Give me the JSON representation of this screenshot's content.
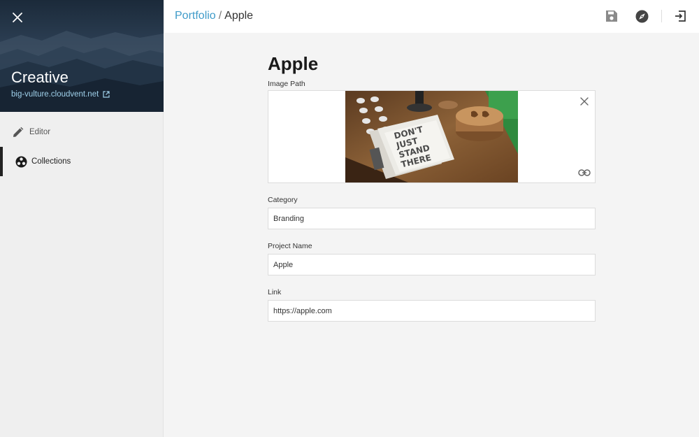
{
  "sidebar": {
    "title": "Creative",
    "site_link": "big-vulture.cloudvent.net",
    "items": [
      {
        "label": "Editor",
        "icon": "pencil-icon"
      },
      {
        "label": "Collections",
        "icon": "collections-icon"
      }
    ]
  },
  "topbar": {
    "breadcrumb_parent": "Portfolio",
    "breadcrumb_sep": "/",
    "breadcrumb_current": "Apple",
    "icons": [
      "save-icon",
      "compass-icon",
      "exit-icon"
    ]
  },
  "form": {
    "page_title": "Apple",
    "image_label": "Image Path",
    "category_label": "Category",
    "category_value": "Branding",
    "project_label": "Project Name",
    "project_value": "Apple",
    "link_label": "Link",
    "link_value": "https://apple.com",
    "image_text": [
      "DON'T",
      "JUST",
      "STAND",
      "THERE"
    ]
  },
  "colors": {
    "accent": "#3f9bc9",
    "sidebar_bg": "#efefef",
    "content_bg": "#f4f4f4"
  }
}
